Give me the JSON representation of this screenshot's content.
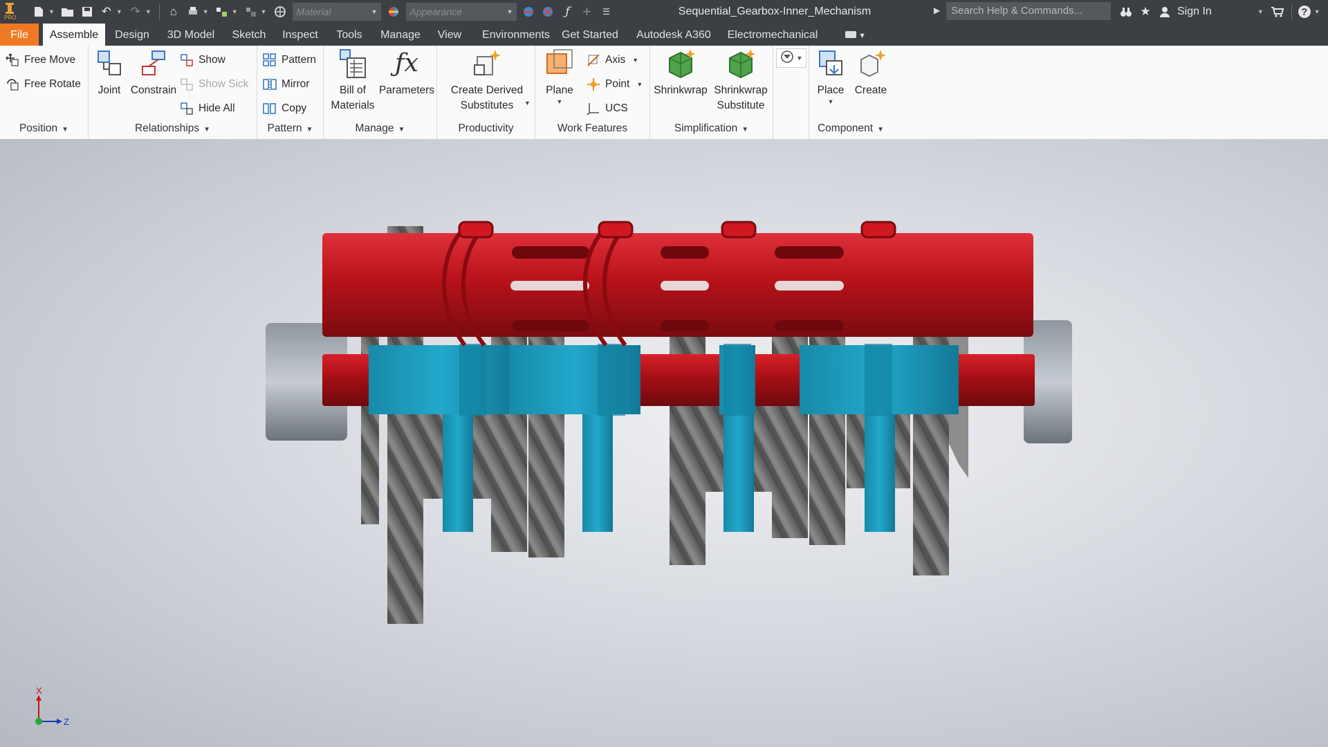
{
  "app": {
    "document_title": "Sequential_Gearbox-Inner_Mechanism",
    "material_placeholder": "Material",
    "appearance_placeholder": "Appearance",
    "search_placeholder": "Search Help & Commands...",
    "sign_in": "Sign In",
    "logo_badge": "PRO"
  },
  "tabs": [
    "File",
    "Assemble",
    "Design",
    "3D Model",
    "Sketch",
    "Inspect",
    "Tools",
    "Manage",
    "View",
    "Environments",
    "Get Started",
    "Autodesk A360",
    "Electromechanical"
  ],
  "active_tab": "Assemble",
  "ribbon": {
    "position": {
      "label": "Position",
      "free_move": "Free Move",
      "free_rotate": "Free Rotate"
    },
    "relationships": {
      "label": "Relationships",
      "joint": "Joint",
      "constrain": "Constrain",
      "show": "Show",
      "show_sick": "Show Sick",
      "hide_all": "Hide All"
    },
    "pattern": {
      "label": "Pattern",
      "pattern": "Pattern",
      "mirror": "Mirror",
      "copy": "Copy"
    },
    "manage": {
      "label": "Manage",
      "bom_line1": "Bill of",
      "bom_line2": "Materials",
      "parameters": "Parameters"
    },
    "productivity": {
      "label": "Productivity",
      "derived_line1": "Create Derived",
      "derived_line2": "Substitutes"
    },
    "work_features": {
      "label": "Work Features",
      "plane": "Plane",
      "axis": "Axis",
      "point": "Point",
      "ucs": "UCS"
    },
    "simplification": {
      "label": "Simplification",
      "shrinkwrap": "Shrinkwrap",
      "sub_line1": "Shrinkwrap",
      "sub_line2": "Substitute"
    },
    "component": {
      "label": "Component",
      "place": "Place",
      "create": "Create"
    }
  },
  "viewcube": {
    "axis_x": "X",
    "axis_z": "Z"
  },
  "colors": {
    "title_bar": "#3c3f44",
    "file_tab": "#f07a23",
    "drum": "#c8121a",
    "fork": "#1a9cbc",
    "gear": "#6f6f6f"
  }
}
